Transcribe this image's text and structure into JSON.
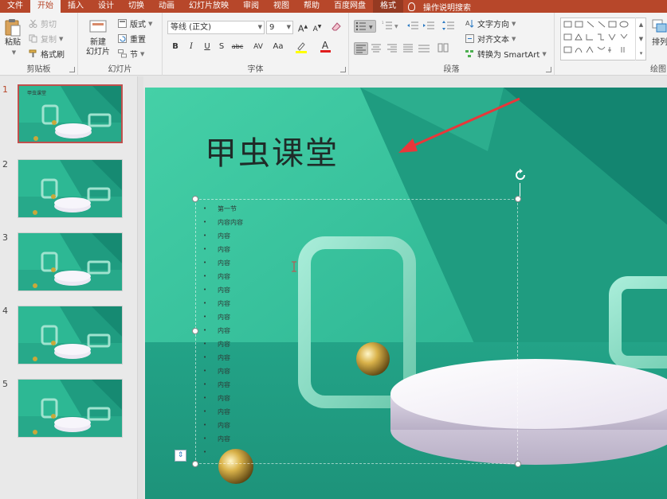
{
  "menubar": {
    "tabs": [
      "文件",
      "开始",
      "插入",
      "设计",
      "切换",
      "动画",
      "幻灯片放映",
      "审阅",
      "视图",
      "帮助",
      "百度网盘",
      "格式"
    ],
    "active_tab": "开始",
    "tell_me": "操作说明搜索"
  },
  "ribbon": {
    "clipboard": {
      "paste": "粘贴",
      "cut": "剪切",
      "copy": "复制",
      "format_painter": "格式刷",
      "label": "剪贴板"
    },
    "slides": {
      "new_slide_line1": "新建",
      "new_slide_line2": "幻灯片",
      "layout": "版式",
      "reset": "重置",
      "section": "节",
      "label": "幻灯片"
    },
    "font": {
      "font_name": "等线 (正文)",
      "font_size": "9",
      "bold": "B",
      "italic": "I",
      "underline": "U",
      "strike": "S",
      "strikethrough_abc": "abc",
      "spacing": "AV",
      "case": "Aa",
      "font_color": "A",
      "label": "字体"
    },
    "paragraph": {
      "text_direction": "文字方向",
      "align_text": "对齐文本",
      "smartart": "转换为 SmartArt",
      "label": "段落"
    },
    "drawing": {
      "arrange": "排列",
      "label": "绘图"
    }
  },
  "thumbnails": [
    {
      "number": "1",
      "title": "甲虫课堂",
      "active": true
    },
    {
      "number": "2",
      "title": "",
      "active": false
    },
    {
      "number": "3",
      "title": "",
      "active": false
    },
    {
      "number": "4",
      "title": "",
      "active": false
    },
    {
      "number": "5",
      "title": "",
      "active": false
    }
  ],
  "slide": {
    "title": "甲虫课堂",
    "bullets": [
      "第一节",
      "内容内容",
      "内容",
      "内容",
      "内容",
      "内容",
      "内容",
      "内容",
      "内容",
      "内容",
      "内容",
      "内容",
      "内容",
      "内容",
      "内容",
      "内容",
      "内容",
      "内容"
    ]
  },
  "colors": {
    "accent": "#b7472a",
    "slide_teal": "#2bb89a",
    "arrow_red": "#e8373a"
  }
}
